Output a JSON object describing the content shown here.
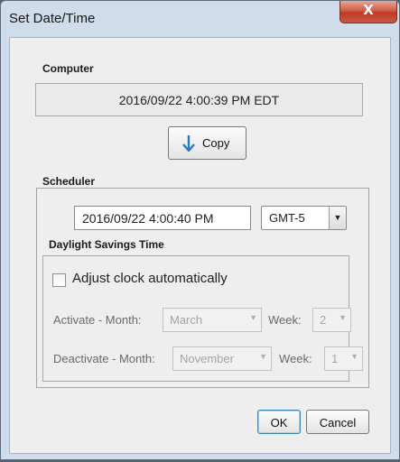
{
  "window": {
    "title": "Set Date/Time",
    "close_glyph": "X"
  },
  "computer": {
    "label": "Computer",
    "time": "2016/09/22 4:00:39 PM  EDT"
  },
  "copy_button": {
    "label": "Copy",
    "icon": "down-arrow-icon"
  },
  "scheduler": {
    "label": "Scheduler",
    "time_value": "2016/09/22 4:00:40 PM",
    "timezone": "GMT-5"
  },
  "dst": {
    "label": "Daylight Savings Time",
    "adjust_label": "Adjust clock automatically",
    "adjust_checked": false,
    "activate_label": "Activate  -  Month:",
    "activate_month": "March",
    "activate_week_label": "Week:",
    "activate_week": "2",
    "deactivate_label": "Deactivate - Month:",
    "deactivate_month": "November",
    "deactivate_week_label": "Week:",
    "deactivate_week": "1"
  },
  "buttons": {
    "ok": "OK",
    "cancel": "Cancel"
  },
  "colors": {
    "accent": "#3c7fb1",
    "close": "#c75a44",
    "frame": "#cfdcec"
  }
}
